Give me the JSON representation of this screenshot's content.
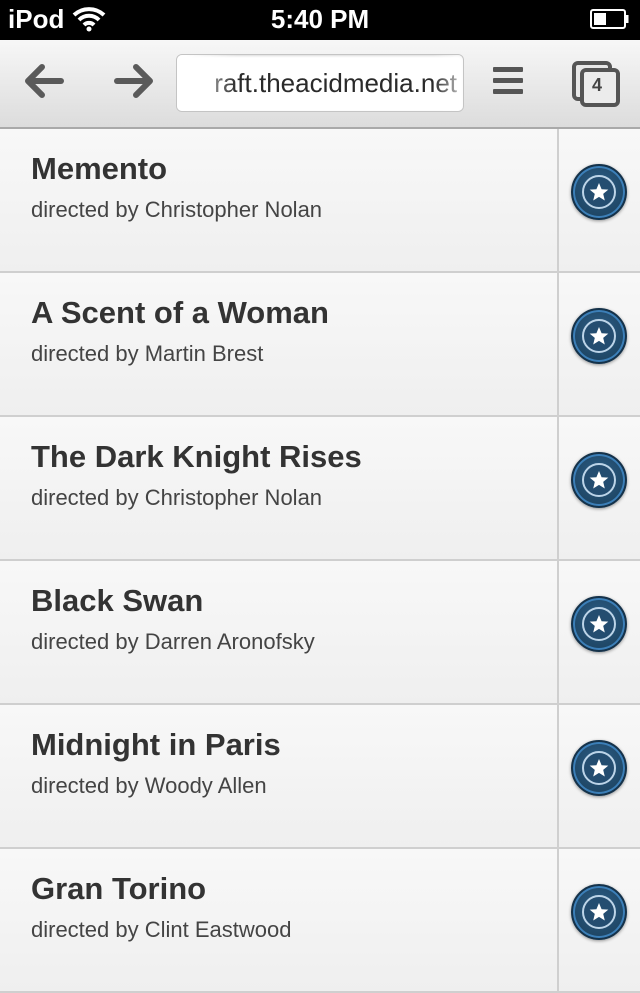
{
  "status_bar": {
    "carrier": "iPod",
    "time": "5:40 PM"
  },
  "browser": {
    "url": "raft.theacidmedia.net",
    "tab_count": "4"
  },
  "movies": [
    {
      "title": "Memento",
      "director": "directed by Christopher Nolan"
    },
    {
      "title": "A Scent of a Woman",
      "director": "directed by Martin Brest"
    },
    {
      "title": "The Dark Knight Rises",
      "director": "directed by Christopher Nolan"
    },
    {
      "title": "Black Swan",
      "director": "directed by Darren Aronofsky"
    },
    {
      "title": "Midnight in Paris",
      "director": "directed by Woody Allen"
    },
    {
      "title": "Gran Torino",
      "director": "directed by Clint Eastwood"
    }
  ],
  "icons": {
    "wifi": "wifi-icon",
    "battery": "battery-icon",
    "back": "back-arrow-icon",
    "forward": "forward-arrow-icon",
    "menu": "menu-icon",
    "tabs": "tabs-icon",
    "favorite": "star-icon"
  },
  "colors": {
    "favorite_button": "#2d5e87",
    "row_text": "#333333"
  }
}
